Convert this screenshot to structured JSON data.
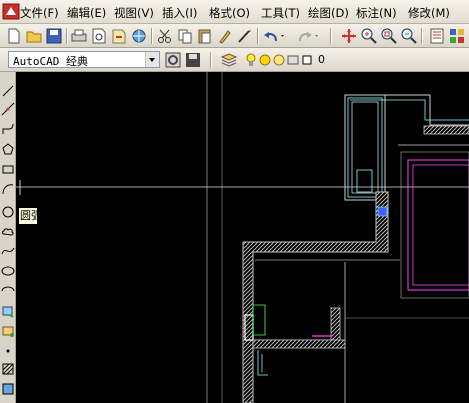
{
  "menubar": {
    "items": [
      "文件(F)",
      "编辑(E)",
      "视图(V)",
      "插入(I)",
      "格式(O)",
      "工具(T)",
      "绘图(D)",
      "标注(N)",
      "修改(M)"
    ]
  },
  "toolbar2": {
    "workspace_value": "AutoCAD 经典",
    "layer_value": "0"
  },
  "tooltip": {
    "text": "圆弧"
  },
  "colors": {
    "canvas": "#000000",
    "wall_hatch": "#c8c8c8",
    "cyan_line": "#80ffff",
    "magenta_line": "#ff40ff",
    "green_line": "#40ff40",
    "blue_line": "#4060ff"
  }
}
